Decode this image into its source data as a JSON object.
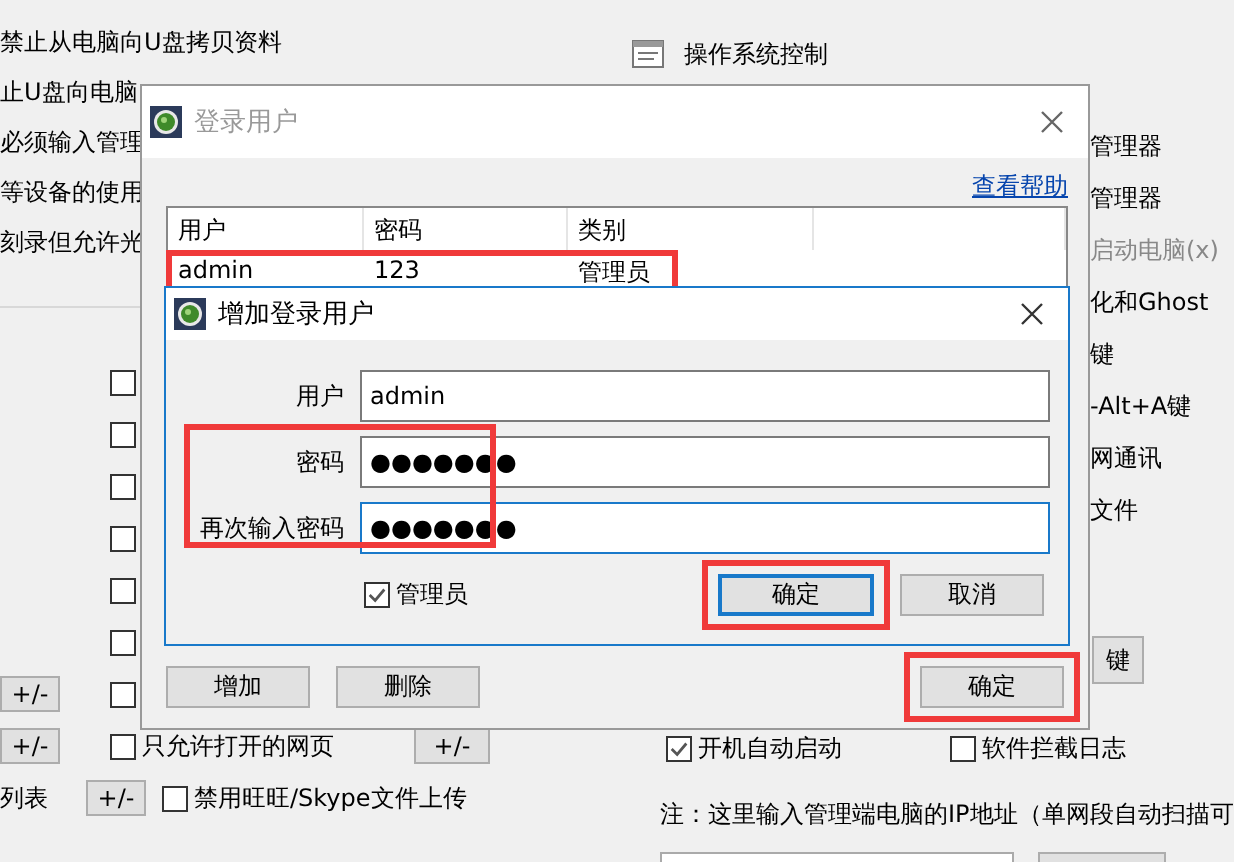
{
  "background": {
    "top_items": [
      "禁止从电脑向U盘拷贝资料",
      "止U盘向电脑",
      "必须输入管理",
      "等设备的使用",
      "刻录但允许光"
    ],
    "section_title": "操作系统控制",
    "side_items": [
      {
        "text": "管理器",
        "disabled": false
      },
      {
        "text": "管理器",
        "disabled": false
      },
      {
        "text": "启动电脑(x)",
        "disabled": true
      },
      {
        "text": "化和Ghost",
        "disabled": false
      },
      {
        "text": "键",
        "disabled": false
      },
      {
        "text": "-Alt+A键",
        "disabled": false
      },
      {
        "text": "网通讯",
        "disabled": false
      },
      {
        "text": "文件",
        "disabled": false
      }
    ],
    "middle_checkboxes": [
      {
        "checked": false
      },
      {
        "checked": false
      },
      {
        "checked": false
      },
      {
        "checked": false
      },
      {
        "checked": false
      },
      {
        "checked": false
      },
      {
        "checked": false
      }
    ],
    "side_buttons": [
      "+/-",
      "+/-"
    ],
    "list_label": "列表",
    "list_button": "+/-",
    "web_option": {
      "label": "只允许打开的网页",
      "checked": false,
      "button": "+/-"
    },
    "upload_option": {
      "label": "禁用旺旺/Skype文件上传",
      "checked": false
    },
    "key_button": "键",
    "startup_options": [
      {
        "label": "开机自动启动",
        "checked": true
      },
      {
        "label": "软件拦截日志",
        "checked": false
      }
    ],
    "note": "注：这里输入管理端电脑的IP地址（单网段自动扫描可"
  },
  "dialog": {
    "title": "登录用户",
    "active": false,
    "help_link": "查看帮助",
    "columns": [
      "用户",
      "密码",
      "类别"
    ],
    "rows": [
      {
        "cells": [
          "admin",
          "123",
          "管理员"
        ],
        "highlighted": true
      }
    ],
    "buttons": [
      "增加",
      "删除"
    ],
    "ok_button": {
      "label": "确定",
      "highlighted": true
    }
  },
  "add_dialog": {
    "title": "增加登录用户",
    "fields": [
      {
        "label": "用户",
        "value": "admin",
        "focused": false
      },
      {
        "label": "密码",
        "value": "●●●●●●●",
        "focused": false
      },
      {
        "label": "再次输入密码",
        "value": "●●●●●●●",
        "focused": true
      }
    ],
    "password_highlight": true,
    "admin_checkbox": {
      "label": "管理员",
      "checked": true
    },
    "ok_button": {
      "label": "确定",
      "default": true,
      "highlighted": true
    },
    "cancel_button": "取消"
  }
}
